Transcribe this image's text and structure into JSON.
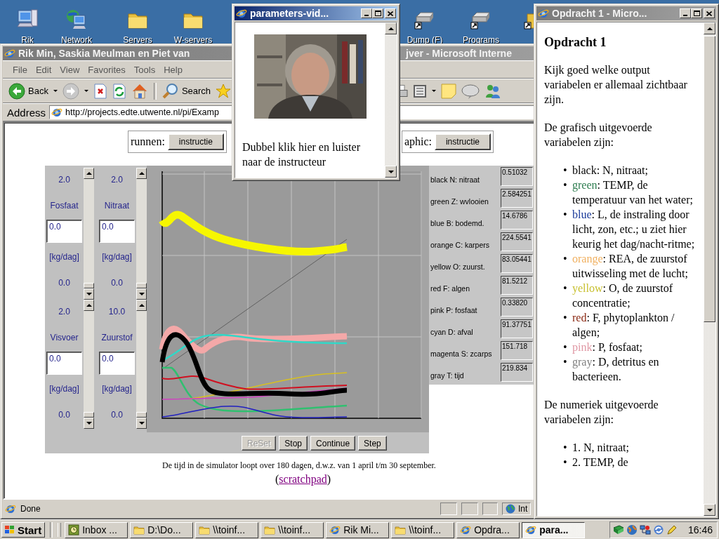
{
  "desktop_icons": [
    {
      "label": "Rik",
      "kind": "computer"
    },
    {
      "label": "Network",
      "kind": "network"
    },
    {
      "label": "Servers",
      "kind": "folder"
    },
    {
      "label": "W-servers",
      "kind": "folder"
    },
    {
      "label": "Dump (F)",
      "kind": "drive"
    },
    {
      "label": "Programs",
      "kind": "drive"
    },
    {
      "kind": "shortcut-folder"
    }
  ],
  "browser_window": {
    "active": false,
    "title_start": "Rik Min, Saskia Meulman en Piet van",
    "title_end": "jver - Microsoft Interne",
    "menu": [
      "File",
      "Edit",
      "View",
      "Favorites",
      "Tools",
      "Help"
    ],
    "back": "Back",
    "search": "Search",
    "address_label": "Address",
    "address": "http://projects.edte.utwente.nl/pi/Examp",
    "instruction_bar": [
      {
        "label": "runnen:",
        "button": "instructie"
      },
      {
        "label": "aphic:",
        "button": "instructie"
      }
    ],
    "simulation": {
      "parameters": [
        {
          "max": "2.0",
          "name": "Fosfaat",
          "value": "0.0",
          "unit": "[kg/dag]",
          "min": "0.0",
          "level": 0
        },
        {
          "max": "2.0",
          "name": "Nitraat",
          "value": "0.0",
          "unit": "[kg/dag]",
          "min": "0.0",
          "level": 0
        },
        {
          "max": "2.0",
          "name": "Visvoer",
          "value": "0.0",
          "unit": "[kg/dag]",
          "min": "0.0",
          "level": 0
        },
        {
          "max": "10.0",
          "name": "Zuurstof",
          "value": "0.0",
          "unit": "[kg/dag]",
          "min": "0.0",
          "level": 0
        }
      ],
      "buttons": [
        {
          "label": "ReSet",
          "disabled": true
        },
        {
          "label": "Stop",
          "disabled": false
        },
        {
          "label": "Continue",
          "disabled": false
        },
        {
          "label": "Step",
          "disabled": false
        }
      ],
      "outputs": [
        {
          "label": "black N: nitraat",
          "value": "0.51032"
        },
        {
          "label": "green Z: wvlooien",
          "value": "2.584251"
        },
        {
          "label": "blue B: bodemd.",
          "value": "14.6786"
        },
        {
          "label": "orange C: karpers",
          "value": "224.5541"
        },
        {
          "label": "yellow O: zuurst.",
          "value": "83.05441"
        },
        {
          "label": "red F: algen",
          "value": "81.5212"
        },
        {
          "label": "pink P: fosfaat",
          "value": "0.33820"
        },
        {
          "label": "cyan D: afval",
          "value": "91.37751"
        },
        {
          "label": "magenta S: zcarps",
          "value": "151.718"
        },
        {
          "label": "gray T: tijd",
          "value": "219.834"
        }
      ]
    },
    "caption": "De tijd in de simulator loopt over 180 dagen, d.w.z. van 1 april t/m 30 september.",
    "scratchpad": {
      "before": "(",
      "link": "scratchpad",
      "after": ")"
    },
    "status": "Done",
    "zone": "Int"
  },
  "video_window": {
    "active": true,
    "title": "parameters-vid...",
    "text": "Dubbel klik hier en luister naar de instructeur"
  },
  "task_window": {
    "active": false,
    "title": "Opdracht 1 - Micro...",
    "heading": "Opdracht 1",
    "intro": "Kijk goed welke output variabelen er allemaal zichtbaar zijn.",
    "graphic_heading": "De grafisch uitgevoerde variabelen zijn:",
    "graphic_items": [
      {
        "marker": "•",
        "word": "black",
        "color": "#000000",
        "text": ": N, nitraat;"
      },
      {
        "marker": "•",
        "word": "green",
        "color": "#2e7d50",
        "text": ": TEMP, de temperatuur van het water;"
      },
      {
        "marker": "•",
        "word": "blue",
        "color": "#1a3a9a",
        "text": ": L, de instraling door licht, zon, etc.; u ziet hier keurig het dag/nacht-ritme;"
      },
      {
        "marker": "•",
        "word": "orange",
        "color": "#f0b060",
        "text": ": REA, de zuurstof uitwisseling met de lucht;"
      },
      {
        "marker": "•",
        "word": "yellow",
        "color": "#c8c030",
        "text": ": O, de zuurstof concentratie;"
      },
      {
        "marker": "•",
        "word": "red",
        "color": "#8b2a14",
        "text": ": F, phytoplankton / algen;"
      },
      {
        "marker": "•",
        "word": "pink",
        "color": "#e098a4",
        "text": ": P, fosfaat;"
      },
      {
        "marker": "•",
        "word": "gray",
        "color": "#808080",
        "text": ": D, detritus en bacterieen."
      }
    ],
    "numeric_heading": "De numeriek uitgevoerde variabelen zijn:",
    "numeric_items": [
      {
        "marker": "•",
        "text": "1. N, nitraat;"
      },
      {
        "marker": "•",
        "text": "2. TEMP, de"
      }
    ]
  },
  "taskbar": {
    "start": "Start",
    "buttons": [
      {
        "label": "Inbox ...",
        "kind": "mail",
        "selected": false
      },
      {
        "label": "D:\\Do...",
        "kind": "folder",
        "selected": false
      },
      {
        "label": "\\\\toinf...",
        "kind": "folder",
        "selected": false
      },
      {
        "label": "\\\\toinf...",
        "kind": "folder",
        "selected": false
      },
      {
        "label": "Rik Mi...",
        "kind": "browser",
        "selected": false
      },
      {
        "label": "\\\\toinf...",
        "kind": "folder",
        "selected": false
      },
      {
        "label": "Opdra...",
        "kind": "browser",
        "selected": false
      },
      {
        "label": "para...",
        "kind": "browser",
        "selected": true
      }
    ],
    "clock": "16:46"
  }
}
